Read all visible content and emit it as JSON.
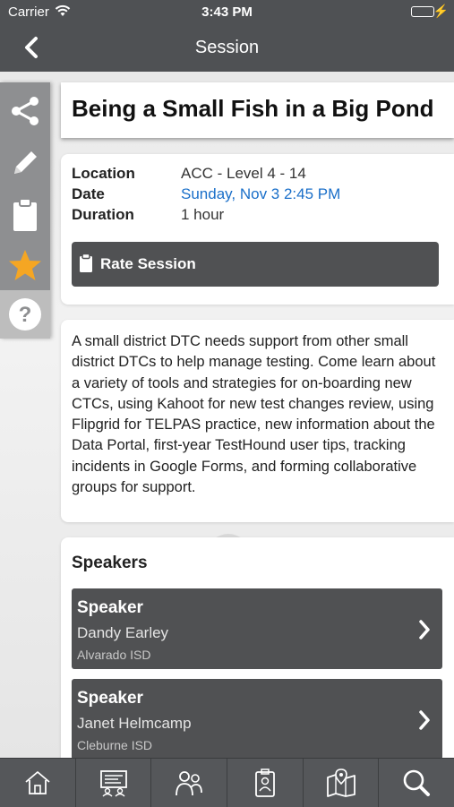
{
  "status_bar": {
    "carrier": "Carrier",
    "time": "3:43 PM"
  },
  "nav": {
    "title": "Session",
    "back_icon": "chevron-left-icon"
  },
  "sidebar": {
    "items": [
      {
        "icon": "share-icon"
      },
      {
        "icon": "pencil-icon"
      },
      {
        "icon": "clipboard-icon"
      },
      {
        "icon": "star-icon",
        "color": "#f5a623"
      },
      {
        "icon": "help-icon"
      }
    ]
  },
  "session": {
    "title": "Being a Small Fish in a Big Pond",
    "location_label": "Location",
    "location": "ACC - Level 4 - 14",
    "date_label": "Date",
    "date": "Sunday, Nov 3 2:45 PM",
    "duration_label": "Duration",
    "duration": "1 hour",
    "rate_label": "Rate Session",
    "description": "A small district DTC needs support from other small district DTCs to help manage testing. Come learn about a variety of tools and strategies for on-boarding new CTCs, using Kahoot for new test changes review, using Flipgrid for TELPAS practice, new information about the Data Portal, first-year TestHound user tips, tracking incidents in Google Forms, and forming collaborative groups for support."
  },
  "speakers": {
    "heading": "Speakers",
    "list": [
      {
        "role": "Speaker",
        "name": "Dandy Earley",
        "org": "Alvarado ISD"
      },
      {
        "role": "Speaker",
        "name": "Janet Helmcamp",
        "org": "Cleburne ISD"
      }
    ]
  },
  "tab_bar": {
    "tabs": [
      {
        "icon": "home-icon"
      },
      {
        "icon": "agenda-board-icon"
      },
      {
        "icon": "people-icon"
      },
      {
        "icon": "badge-icon"
      },
      {
        "icon": "map-icon"
      },
      {
        "icon": "search-icon"
      }
    ]
  },
  "colors": {
    "bar": "#4f5154",
    "accent_link": "#1a6fc9",
    "star": "#f5a623",
    "battery": "#4cd964"
  }
}
